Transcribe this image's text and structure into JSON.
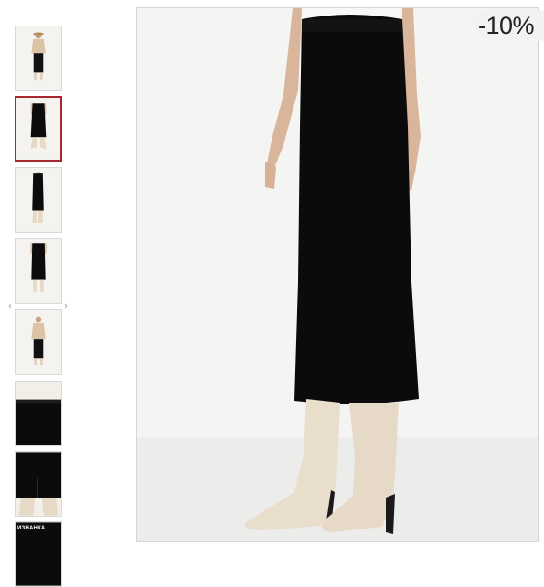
{
  "gallery": {
    "thumbnails": [
      {
        "view": "full-look-with-top",
        "active": false
      },
      {
        "view": "skirt-front",
        "active": true
      },
      {
        "view": "skirt-side",
        "active": false
      },
      {
        "view": "skirt-back",
        "active": false
      },
      {
        "view": "full-look-with-top-2",
        "active": false
      },
      {
        "view": "fabric-closeup",
        "active": false
      },
      {
        "view": "slit-closeup",
        "active": false
      },
      {
        "view": "inside-out-label",
        "active": false,
        "label": "ИЗНАНКА"
      }
    ],
    "prev_arrow": "‹",
    "next_arrow": "›"
  },
  "main_image": {
    "view": "skirt-front",
    "discount_badge": "-10%"
  },
  "colors": {
    "active_border": "#a8292c",
    "skirt": "#0b0b0c",
    "boots": "#e9ddcc",
    "background": "#f3f3f1"
  }
}
